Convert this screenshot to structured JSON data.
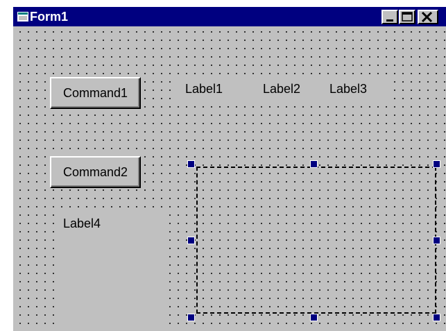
{
  "window": {
    "title": "Form1",
    "colors": {
      "titlebar": "#000080",
      "face": "#c0c0c0",
      "handle": "#000080"
    }
  },
  "controls": {
    "command1": {
      "caption": "Command1"
    },
    "command2": {
      "caption": "Command2"
    },
    "label1": {
      "caption": "Label1"
    },
    "label2": {
      "caption": "Label2"
    },
    "label3": {
      "caption": "Label3"
    },
    "label4": {
      "caption": "Label4"
    }
  },
  "icons": {
    "app": "form-icon",
    "minimize": "minimize-icon",
    "maximize": "maximize-icon",
    "close": "close-icon"
  }
}
